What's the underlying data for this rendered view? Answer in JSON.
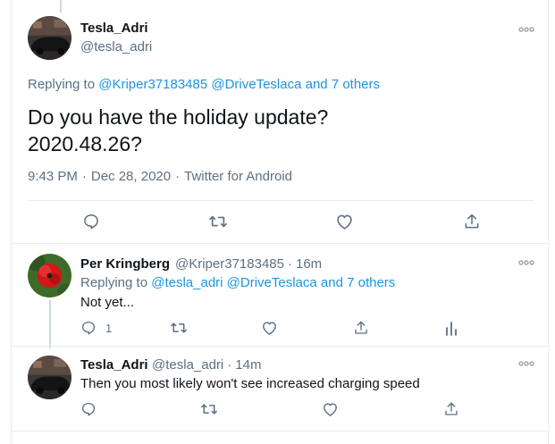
{
  "main_tweet": {
    "author_name": "Tesla_Adri",
    "author_handle": "@tesla_adri",
    "replying_prefix": "Replying to",
    "replying_mentions": "@Kriper37183485 @DriveTeslaca and 7 others",
    "text_line1": "Do you have the holiday update?",
    "text_line2": "2020.48.26?",
    "time": "9:43 PM",
    "date": "Dec 28, 2020",
    "source": "Twitter for Android",
    "separator": "·"
  },
  "reply1": {
    "author_name": "Per Kringberg",
    "author_handle": "@Kriper37183485",
    "age": "16m",
    "separator": "·",
    "replying_prefix": "Replying to",
    "replying_mentions": "@tesla_adri @DriveTeslaca and 7 others",
    "text": "Not yet...",
    "reply_count": "1"
  },
  "reply2": {
    "author_name": "Tesla_Adri",
    "author_handle": "@tesla_adri",
    "age": "14m",
    "separator": "·",
    "text": "Then you most likely won't see increased charging speed"
  },
  "icons": {
    "reply": "reply-bubble-icon",
    "retweet": "retweet-icon",
    "like": "heart-icon",
    "share": "share-icon",
    "analytics": "analytics-icon",
    "more": "more-dots-icon"
  },
  "colors": {
    "text": "#0f1419",
    "secondary": "#5b7083",
    "link": "#1b95e0",
    "border": "#e6ecf0"
  }
}
